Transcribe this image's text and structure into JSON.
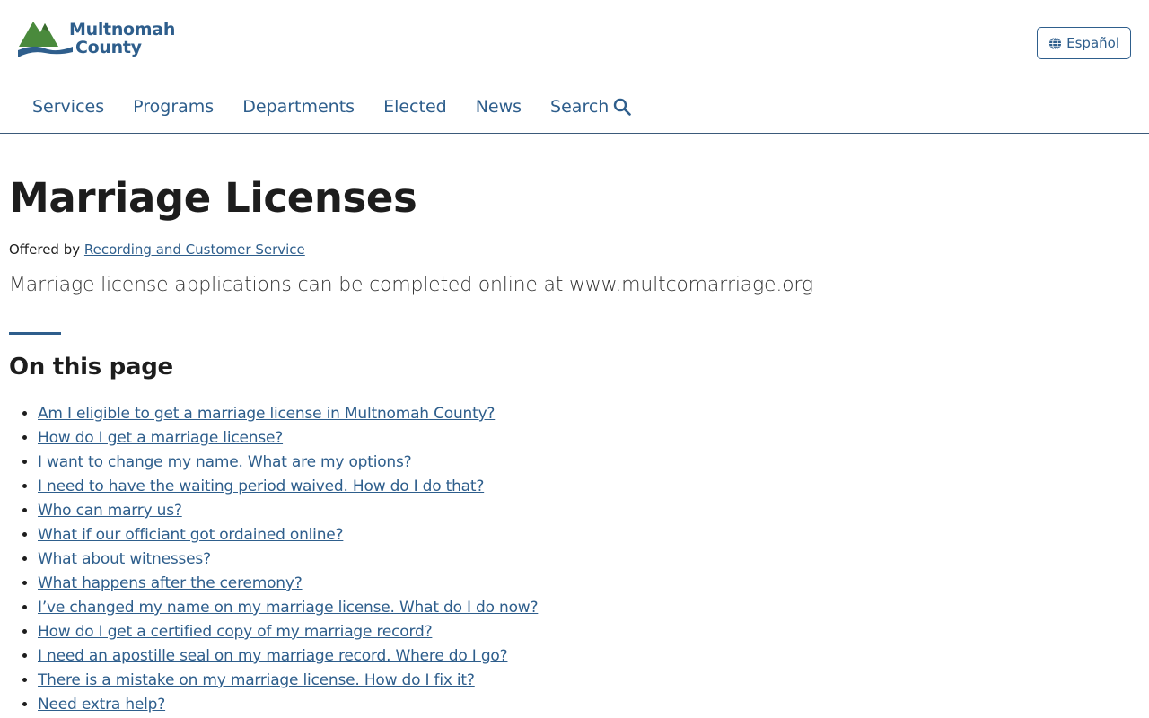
{
  "header": {
    "logo_line1": "Multnomah",
    "logo_line2": "County",
    "lang_button": "Español"
  },
  "nav": {
    "items": [
      "Services",
      "Programs",
      "Departments",
      "Elected",
      "News",
      "Search"
    ]
  },
  "page": {
    "title": "Marriage Licenses",
    "offered_prefix": "Offered by",
    "offered_link": "Recording and Customer Service",
    "lead": "Marriage license applications can be completed online at www.multcomarriage.org",
    "toc_heading": "On this page",
    "toc": [
      "Am I eligible to get a marriage license in Multnomah County?",
      "How do I get a marriage license?",
      "I want to change my name. What are my options?",
      "I need to have the waiting period waived. How do I do that?",
      "Who can marry us?",
      "What if our officiant got ordained online?",
      "What about witnesses?",
      "What happens after the ceremony?",
      "I’ve changed my name on my marriage license. What do I do now?",
      "How do I get a certified copy of my marriage record?",
      "I need an apostille seal on my marriage record. Where do I go?",
      "There is a mistake on my marriage license. How do I fix it?",
      "Need extra help?"
    ]
  },
  "colors": {
    "brand_blue": "#2e5e8c",
    "logo_green": "#4a8a3c"
  },
  "icons": {
    "lang": "globe-icon",
    "search": "search-icon",
    "logo": "multnomah-county-logo"
  }
}
